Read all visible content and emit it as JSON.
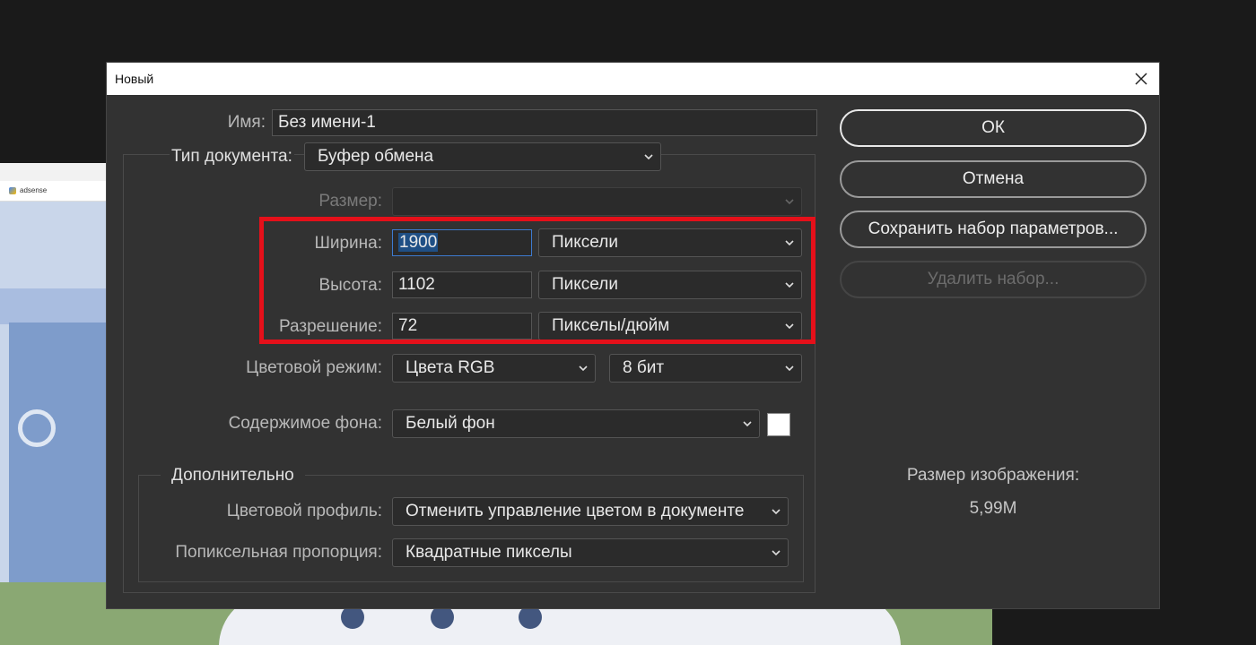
{
  "background_window": {
    "tab_label": "adsense"
  },
  "dialog": {
    "title": "Новый",
    "name_label": "Имя:",
    "name_value": "Без имени-1",
    "doc_type_label": "Тип документа:",
    "doc_type_value": "Буфер обмена",
    "size_label": "Размер:",
    "size_value": "",
    "width_label": "Ширина:",
    "width_value": "1900",
    "width_unit": "Пиксели",
    "height_label": "Высота:",
    "height_value": "1102",
    "height_unit": "Пиксели",
    "resolution_label": "Разрешение:",
    "resolution_value": "72",
    "resolution_unit": "Пикселы/дюйм",
    "color_mode_label": "Цветовой режим:",
    "color_mode_value": "Цвета RGB",
    "bit_depth_value": "8 бит",
    "background_label": "Содержимое фона:",
    "background_value": "Белый фон",
    "background_swatch_color": "#ffffff",
    "advanced_title": "Дополнительно",
    "color_profile_label": "Цветовой профиль:",
    "color_profile_value": "Отменить управление цветом в документе",
    "pixel_aspect_label": "Попиксельная пропорция:",
    "pixel_aspect_value": "Квадратные пикселы"
  },
  "buttons": {
    "ok": "ОК",
    "cancel": "Отмена",
    "save_preset": "Сохранить набор параметров...",
    "delete_preset": "Удалить набор..."
  },
  "info": {
    "image_size_label": "Размер изображения:",
    "image_size_value": "5,99M"
  },
  "colors": {
    "highlight": "#e5101a",
    "dialog_bg": "#323232",
    "selection": "#1f4f85"
  }
}
